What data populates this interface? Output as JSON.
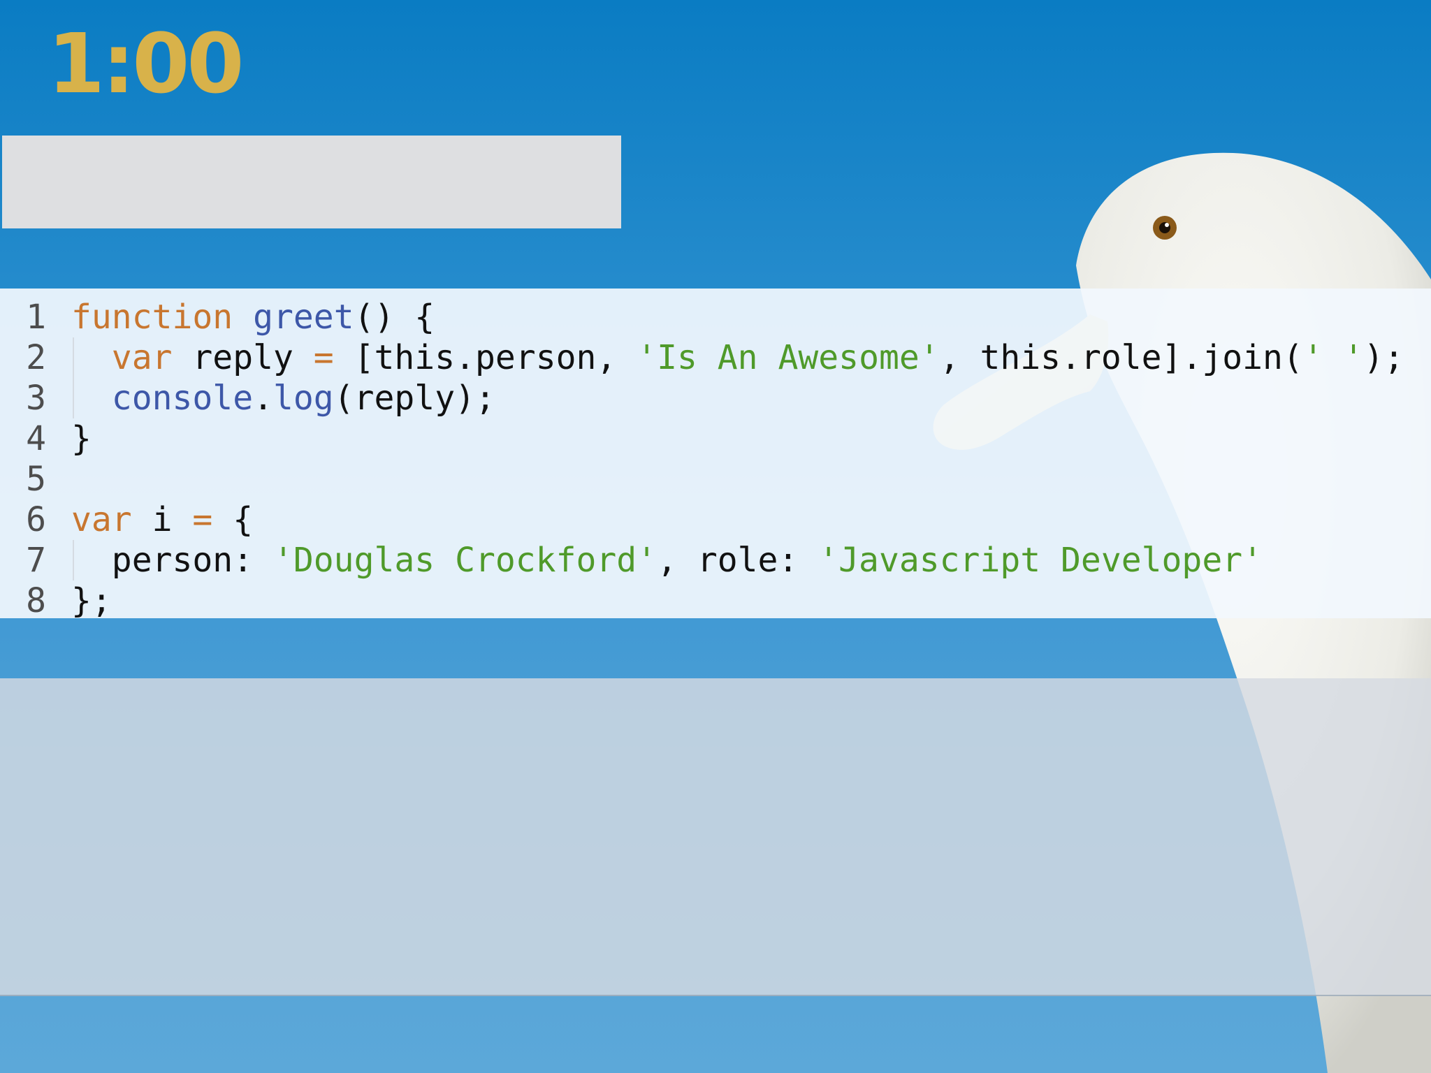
{
  "timer": {
    "text": "1:00"
  },
  "answer_box": {
    "value": ""
  },
  "colors": {
    "timer": "#d8b24a",
    "keyword": "#c8762f",
    "function_name": "#3d57a8",
    "string": "#4f9a2a",
    "sky": "#0b7ec4"
  },
  "code": {
    "lines": [
      {
        "n": "1",
        "tokens": [
          {
            "t": "function",
            "c": "kw"
          },
          {
            "t": " ",
            "c": ""
          },
          {
            "t": "greet",
            "c": "fn"
          },
          {
            "t": "() {",
            "c": ""
          }
        ]
      },
      {
        "n": "2",
        "tokens": [
          {
            "t": "  ",
            "c": ""
          },
          {
            "t": "var",
            "c": "kw"
          },
          {
            "t": " reply ",
            "c": ""
          },
          {
            "t": "=",
            "c": "op"
          },
          {
            "t": " [this.person, ",
            "c": ""
          },
          {
            "t": "'Is An Awesome'",
            "c": "str"
          },
          {
            "t": ", this.role].join(",
            "c": ""
          },
          {
            "t": "' '",
            "c": "str"
          },
          {
            "t": ");",
            "c": ""
          }
        ]
      },
      {
        "n": "3",
        "tokens": [
          {
            "t": "  ",
            "c": ""
          },
          {
            "t": "console",
            "c": "fn"
          },
          {
            "t": ".",
            "c": ""
          },
          {
            "t": "log",
            "c": "fn"
          },
          {
            "t": "(reply);",
            "c": ""
          }
        ]
      },
      {
        "n": "4",
        "tokens": [
          {
            "t": "}",
            "c": ""
          }
        ]
      },
      {
        "n": "5",
        "tokens": []
      },
      {
        "n": "6",
        "tokens": [
          {
            "t": "var",
            "c": "kw"
          },
          {
            "t": " i ",
            "c": ""
          },
          {
            "t": "=",
            "c": "op"
          },
          {
            "t": " {",
            "c": ""
          }
        ]
      },
      {
        "n": "7",
        "tokens": [
          {
            "t": "  person: ",
            "c": ""
          },
          {
            "t": "'Douglas Crockford'",
            "c": "str"
          },
          {
            "t": ", role: ",
            "c": ""
          },
          {
            "t": "'Javascript Developer'",
            "c": "str"
          }
        ]
      },
      {
        "n": "8",
        "tokens": [
          {
            "t": "};",
            "c": ""
          }
        ]
      }
    ]
  }
}
